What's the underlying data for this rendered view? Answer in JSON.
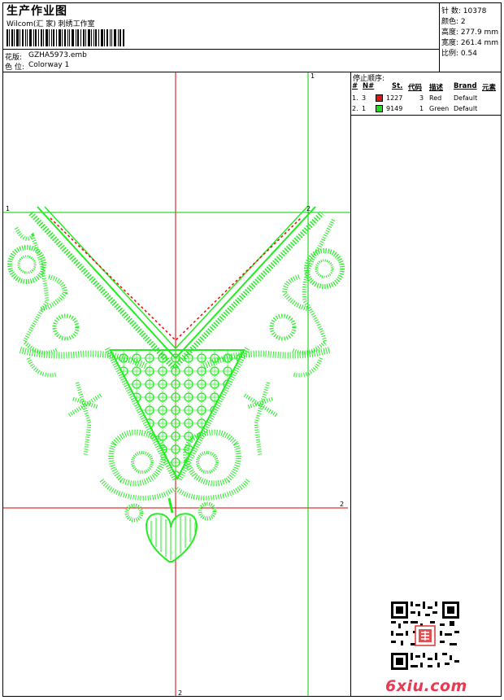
{
  "header": {
    "title": "生产作业图",
    "company": "Wilcom(汇 家) 刺绣工作室",
    "design_label": "花版:",
    "design_file": "GZHA5973.emb",
    "colorway_label": "色 位:",
    "colorway": "Colorway 1"
  },
  "specs": [
    {
      "label": "针 数:",
      "value": "10378"
    },
    {
      "label": "颜色:",
      "value": "2"
    },
    {
      "label": "高度:",
      "value": "277.9 mm"
    },
    {
      "label": "宽度:",
      "value": "261.4 mm"
    },
    {
      "label": "比例:",
      "value": "0.54"
    }
  ],
  "stop_sequence": {
    "title": "停止顺序:",
    "headers": [
      "#",
      "N#",
      "St.",
      "代码",
      "描述",
      "Brand",
      "元素"
    ],
    "rows": [
      {
        "index": "1.",
        "needle": "3",
        "color": "#e31414",
        "code": "1227",
        "stops": "3",
        "desc": "Red",
        "brand": "Default"
      },
      {
        "index": "2.",
        "needle": "1",
        "color": "#22dd22",
        "code": "9149",
        "stops": "1",
        "desc": "Green",
        "brand": "Default"
      }
    ]
  },
  "guides": {
    "label_1": "1",
    "label_2": "2"
  },
  "colors": {
    "guide_red": "#e00000",
    "guide_green": "#00cc00",
    "stitch_green": "#22ee22",
    "stitch_red": "#ee1111"
  },
  "watermark": "6xiu.com"
}
